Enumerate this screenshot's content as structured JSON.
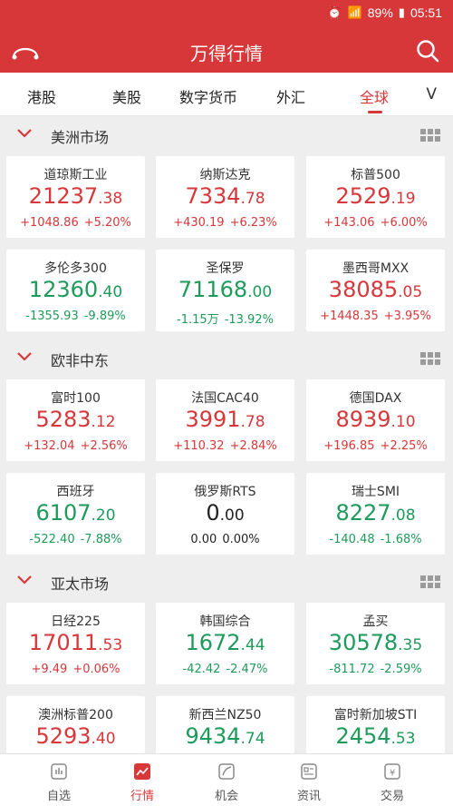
{
  "status": {
    "battery": "89%",
    "time": "05:51"
  },
  "appbar": {
    "title": "万得行情"
  },
  "tabs": [
    {
      "label": "港股",
      "active": false
    },
    {
      "label": "美股",
      "active": false
    },
    {
      "label": "数字货币",
      "active": false
    },
    {
      "label": "外汇",
      "active": false
    },
    {
      "label": "全球",
      "active": true
    }
  ],
  "tabs_more": "V",
  "sections": [
    {
      "title": "美洲市场",
      "cards": [
        {
          "name": "道琼斯工业",
          "int": "21237",
          "dec": ".38",
          "chg": "+1048.86",
          "pct": "+5.20%",
          "dir": "up"
        },
        {
          "name": "纳斯达克",
          "int": "7334",
          "dec": ".78",
          "chg": "+430.19",
          "pct": "+6.23%",
          "dir": "up"
        },
        {
          "name": "标普500",
          "int": "2529",
          "dec": ".19",
          "chg": "+143.06",
          "pct": "+6.00%",
          "dir": "up"
        },
        {
          "name": "多伦多300",
          "int": "12360",
          "dec": ".40",
          "chg": "-1355.93",
          "pct": "-9.89%",
          "dir": "down"
        },
        {
          "name": "圣保罗",
          "int": "71168",
          "dec": ".00",
          "chg": "-1.15万",
          "pct": "-13.92%",
          "dir": "down"
        },
        {
          "name": "墨西哥MXX",
          "int": "38085",
          "dec": ".05",
          "chg": "+1448.35",
          "pct": "+3.95%",
          "dir": "up"
        }
      ]
    },
    {
      "title": "欧非中东",
      "cards": [
        {
          "name": "富时100",
          "int": "5283",
          "dec": ".12",
          "chg": "+132.04",
          "pct": "+2.56%",
          "dir": "up"
        },
        {
          "name": "法国CAC40",
          "int": "3991",
          "dec": ".78",
          "chg": "+110.32",
          "pct": "+2.84%",
          "dir": "up"
        },
        {
          "name": "德国DAX",
          "int": "8939",
          "dec": ".10",
          "chg": "+196.85",
          "pct": "+2.25%",
          "dir": "up"
        },
        {
          "name": "西班牙",
          "int": "6107",
          "dec": ".20",
          "chg": "-522.40",
          "pct": "-7.88%",
          "dir": "down"
        },
        {
          "name": "俄罗斯RTS",
          "int": "0",
          "dec": ".00",
          "chg": "0.00",
          "pct": "0.00%",
          "dir": "flat"
        },
        {
          "name": "瑞士SMI",
          "int": "8227",
          "dec": ".08",
          "chg": "-140.48",
          "pct": "-1.68%",
          "dir": "down"
        }
      ]
    },
    {
      "title": "亚太市场",
      "cards": [
        {
          "name": "日经225",
          "int": "17011",
          "dec": ".53",
          "chg": "+9.49",
          "pct": "+0.06%",
          "dir": "up"
        },
        {
          "name": "韩国综合",
          "int": "1672",
          "dec": ".44",
          "chg": "-42.42",
          "pct": "-2.47%",
          "dir": "down"
        },
        {
          "name": "孟买",
          "int": "30578",
          "dec": ".35",
          "chg": "-811.72",
          "pct": "-2.59%",
          "dir": "down"
        },
        {
          "name": "澳洲标普200",
          "int": "5293",
          "dec": ".40",
          "chg": "",
          "pct": "",
          "dir": "up"
        },
        {
          "name": "新西兰NZ50",
          "int": "9434",
          "dec": ".74",
          "chg": "",
          "pct": "",
          "dir": "down"
        },
        {
          "name": "富时新加坡STI",
          "int": "2454",
          "dec": ".53",
          "chg": "",
          "pct": "",
          "dir": "down"
        }
      ]
    }
  ],
  "bottomnav": [
    {
      "label": "自选",
      "icon": "chart-icon",
      "active": false
    },
    {
      "label": "行情",
      "icon": "market-icon",
      "active": true
    },
    {
      "label": "机会",
      "icon": "opportunity-icon",
      "active": false
    },
    {
      "label": "资讯",
      "icon": "news-icon",
      "active": false
    },
    {
      "label": "交易",
      "icon": "yen-icon",
      "active": false
    }
  ],
  "colors": {
    "brand": "#d8373a",
    "up": "#d8373a",
    "down": "#1e9a5a"
  }
}
